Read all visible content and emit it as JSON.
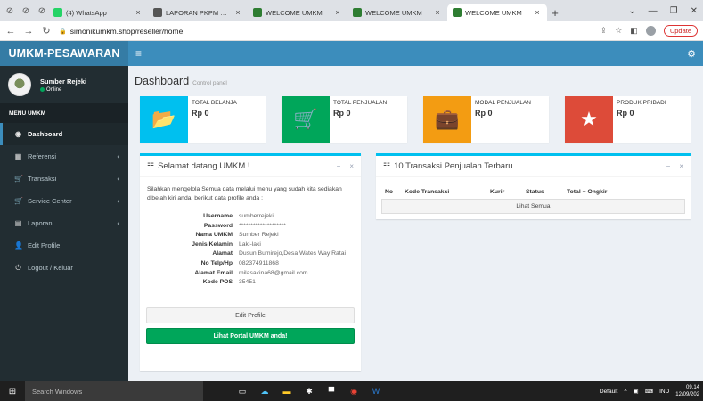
{
  "browser": {
    "tabs": [
      {
        "label": "(4) WhatsApp",
        "color": "#25d366",
        "active": false
      },
      {
        "label": "LAPORAN PKPM KADES...",
        "color": "#555555",
        "active": false
      },
      {
        "label": "WELCOME UMKM",
        "color": "#2e7d32",
        "active": false
      },
      {
        "label": "WELCOME UMKM",
        "color": "#2e7d32",
        "active": false
      },
      {
        "label": "WELCOME UMKM",
        "color": "#2e7d32",
        "active": true
      }
    ],
    "url": "simonikumkm.shop/reseller/home",
    "update_label": "Update"
  },
  "app": {
    "logo": "UMKM-PESAWARAN",
    "user": {
      "name": "Sumber Rejeki",
      "status": "Online"
    },
    "menu_header": "MENU UMKM",
    "menu": [
      {
        "label": "Dashboard",
        "icon": "dashboard-icon",
        "glyph": "◉",
        "active": true,
        "has_children": false
      },
      {
        "label": "Referensi",
        "icon": "grid-icon",
        "glyph": "▦",
        "active": false,
        "has_children": true
      },
      {
        "label": "Transaksi",
        "icon": "cart-icon",
        "glyph": "🛒",
        "active": false,
        "has_children": true
      },
      {
        "label": "Service Center",
        "icon": "cart-icon",
        "glyph": "🛒",
        "active": false,
        "has_children": true
      },
      {
        "label": "Laporan",
        "icon": "book-icon",
        "glyph": "▤",
        "active": false,
        "has_children": true
      },
      {
        "label": "Edit Profile",
        "icon": "user-icon",
        "glyph": "👤",
        "active": false,
        "has_children": false
      },
      {
        "label": "Logout / Keluar",
        "icon": "power-icon",
        "glyph": "⏻",
        "active": false,
        "has_children": false
      }
    ]
  },
  "page": {
    "title": "Dashboard",
    "subtitle": "Control panel"
  },
  "infoboxes": [
    {
      "label": "TOTAL BELANJA",
      "value": "Rp 0",
      "color": "#00c0ef",
      "icon": "folder-icon"
    },
    {
      "label": "TOTAL PENJUALAN",
      "value": "Rp 0",
      "color": "#00a65a",
      "icon": "cart-icon"
    },
    {
      "label": "MODAL PENJUALAN",
      "value": "Rp 0",
      "color": "#f39c12",
      "icon": "briefcase-icon"
    },
    {
      "label": "PRODUK PRIBADI",
      "value": "Rp 0",
      "color": "#dd4b39",
      "icon": "star-icon"
    }
  ],
  "welcome": {
    "title": "Selamat datang UMKM !",
    "intro": "Silahkan mengelola Semua data melalui menu yang sudah kita sediakan dibelah kiri anda, berikut data profile anda :",
    "profile": [
      {
        "label": "Username",
        "value": "sumberrejeki"
      },
      {
        "label": "Password",
        "value": "********************"
      },
      {
        "label": "Nama UMKM",
        "value": "Sumber Rejeki"
      },
      {
        "label": "Jenis Kelamin",
        "value": "Laki-laki"
      },
      {
        "label": "Alamat",
        "value": "Dusun Bumirejo,Desa Wates Way Ratai"
      },
      {
        "label": "No Telp/Hp",
        "value": "082374911868"
      },
      {
        "label": "Alamat Email",
        "value": "milasakina68@gmail.com"
      },
      {
        "label": "Kode POS",
        "value": "35451"
      }
    ],
    "edit_button": "Edit Profile",
    "portal_button": "Lihat Portal UMKM anda!"
  },
  "transactions": {
    "title": "10 Transaksi Penjualan Terbaru",
    "columns": [
      "No",
      "Kode Transaksi",
      "Kurir",
      "Status",
      "Total + Ongkir"
    ],
    "see_all": "Lihat Semua"
  },
  "taskbar": {
    "search_placeholder": "Search Windows",
    "default_label": "Default",
    "lang": "IND",
    "time": "09.14",
    "date": "12/09/202"
  }
}
